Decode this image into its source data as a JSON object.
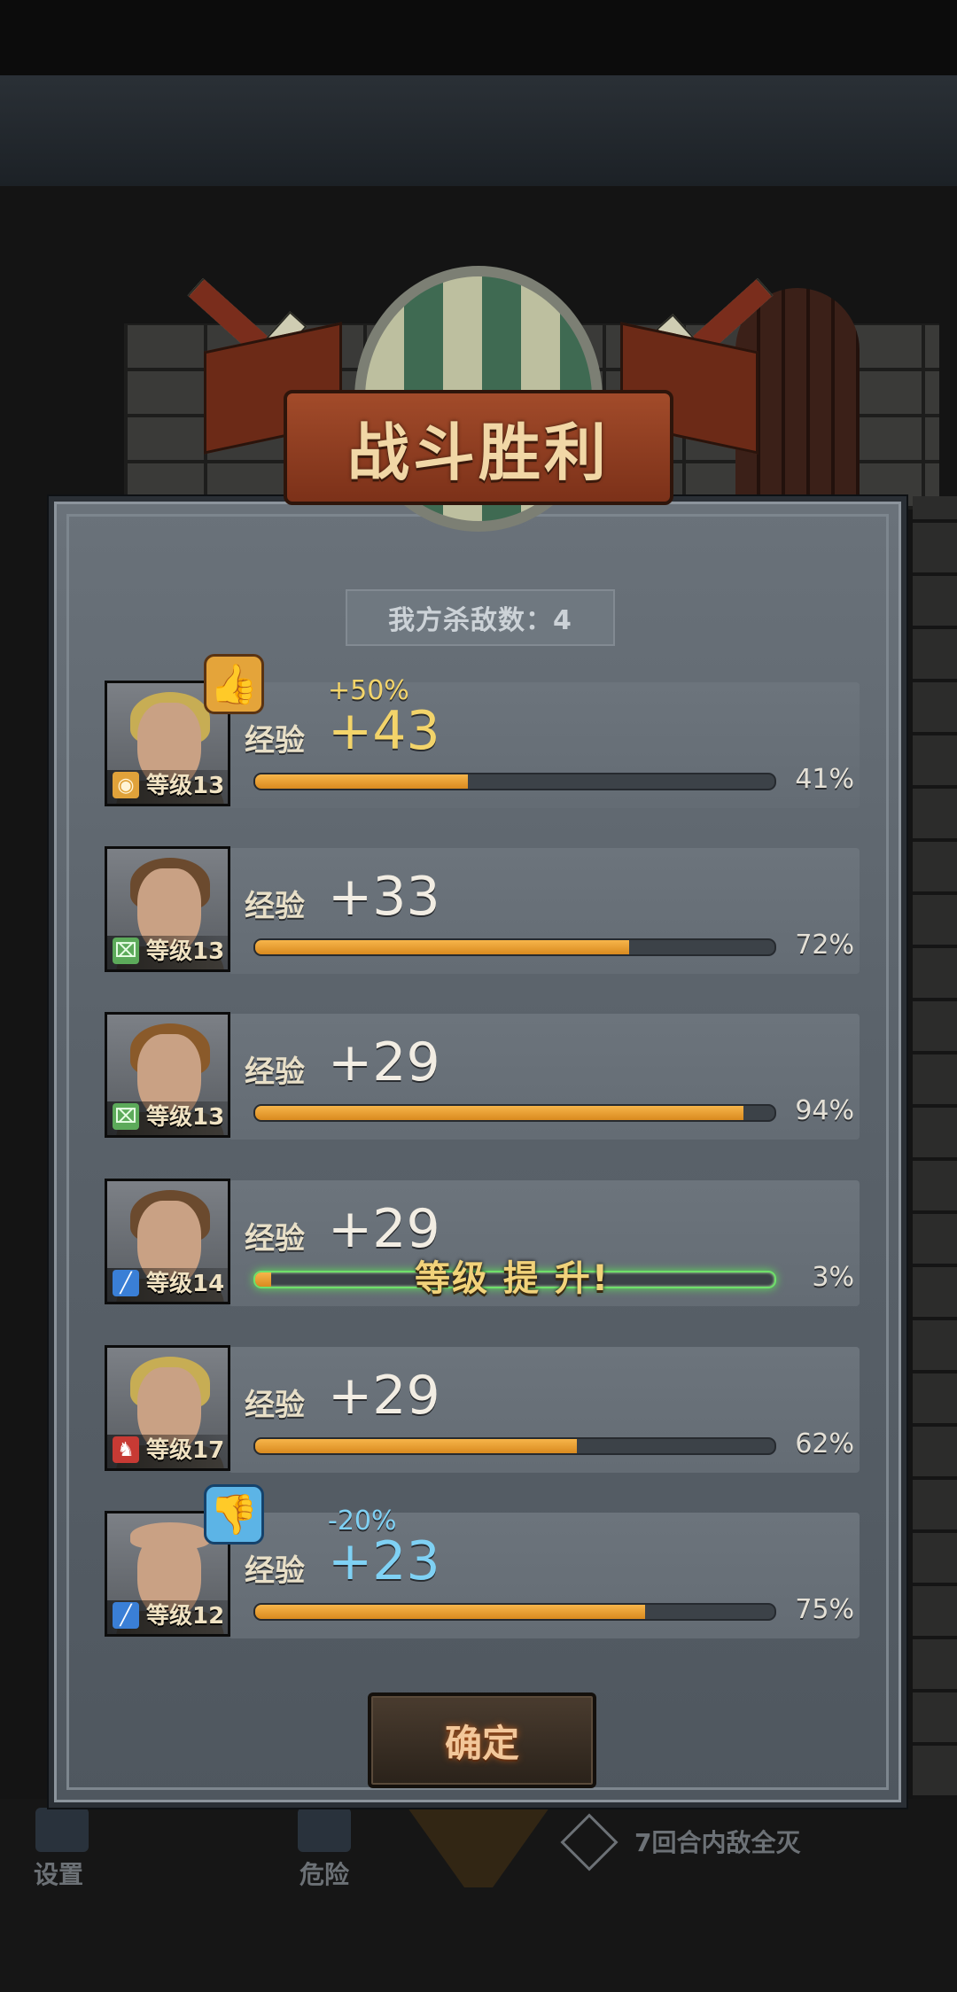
{
  "title": "战斗胜利",
  "kills": "我方杀敌数：4",
  "confirm_label": "确定",
  "levelup_label": "等级 提 升!",
  "heroes": [
    {
      "exp_label": "经验",
      "exp": "+43",
      "bonus": "+50%",
      "level": "等级13",
      "pct": "41%",
      "progress": 0.41,
      "class_icon": "shield-class-icon",
      "mood": "thumbs-up"
    },
    {
      "exp_label": "经验",
      "exp": "+33",
      "level": "等级13",
      "pct": "72%",
      "progress": 0.72,
      "class_icon": "bow-class-icon"
    },
    {
      "exp_label": "经验",
      "exp": "+29",
      "level": "等级13",
      "pct": "94%",
      "progress": 0.94,
      "class_icon": "bow-class-icon"
    },
    {
      "exp_label": "经验",
      "exp": "+29",
      "level": "等级14",
      "pct": "3%",
      "progress": 0.03,
      "class_icon": "sword-class-icon",
      "levelup": true
    },
    {
      "exp_label": "经验",
      "exp": "+29",
      "level": "等级17",
      "pct": "62%",
      "progress": 0.62,
      "class_icon": "horse-class-icon"
    },
    {
      "exp_label": "经验",
      "exp": "+23",
      "bonus": "-20%",
      "level": "等级12",
      "pct": "75%",
      "progress": 0.75,
      "class_icon": "sword-class-icon",
      "mood": "thumbs-down"
    }
  ],
  "bottom_nav": {
    "settings_label": "设置",
    "danger_label": "危险",
    "objective_label": "7回合内敌全灭"
  }
}
